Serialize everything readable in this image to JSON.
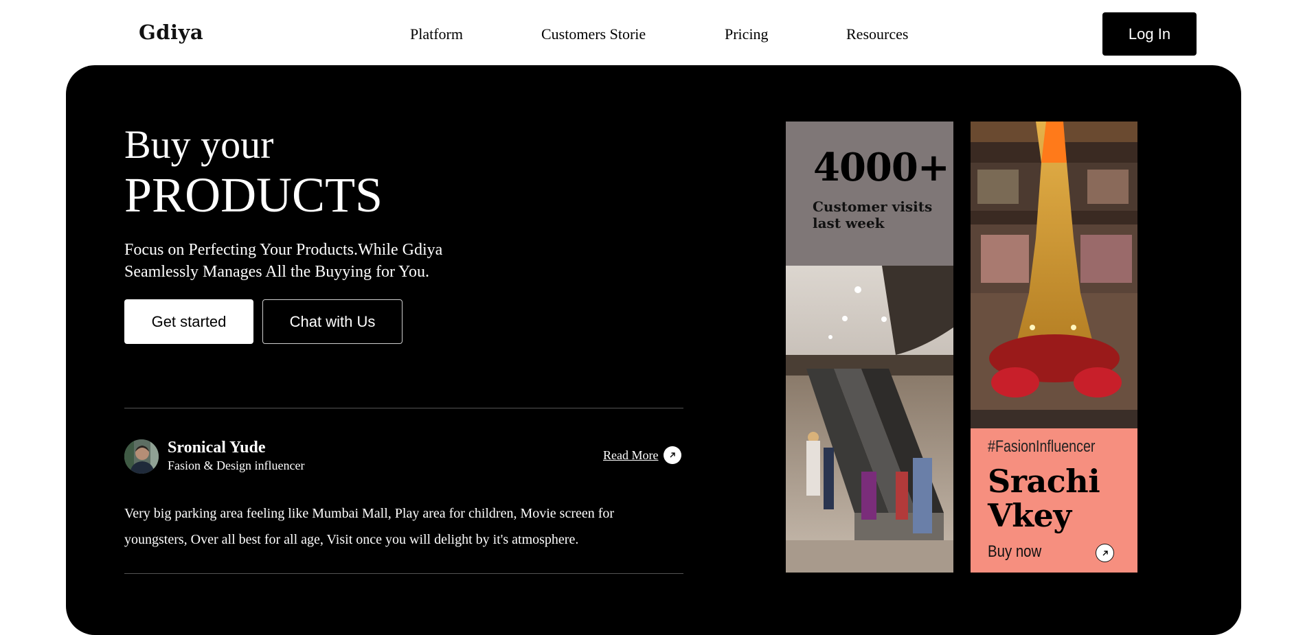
{
  "header": {
    "logo": "Gdiya",
    "nav": [
      "Platform",
      "Customers Storie",
      "Pricing",
      "Resources"
    ],
    "login_label": "Log In"
  },
  "hero": {
    "title_line1": "Buy your",
    "title_line2": "PRODUCTS",
    "subtitle": "Focus on Perfecting Your Products.While Gdiya Seamlessly Manages All the Buyying for You.",
    "primary_cta": "Get started",
    "secondary_cta": "Chat with Us"
  },
  "testimonial": {
    "avatar_icon": "user-avatar",
    "name": "Sronical Yude",
    "role": "Fasion & Design influencer",
    "read_more": "Read More",
    "read_more_icon": "arrow-up-right-icon",
    "text": "Very big parking area feeling like Mumbai Mall, Play area for children, Movie screen for youngsters, Over all best for all age, Visit once you will delight by it's atmosphere."
  },
  "stats_card": {
    "number": "4000+",
    "label": "Customer visits last week",
    "bg_color": "#7f7777"
  },
  "influencer_card": {
    "hashtag": "#FasionInfluencer",
    "name": "Srachi Vkey",
    "cta": "Buy now",
    "cta_icon": "arrow-up-right-icon",
    "bg_color": "#f68f7f"
  },
  "colors": {
    "hero_bg": "#000000",
    "page_bg": "#ffffff",
    "button_dark": "#000000"
  }
}
